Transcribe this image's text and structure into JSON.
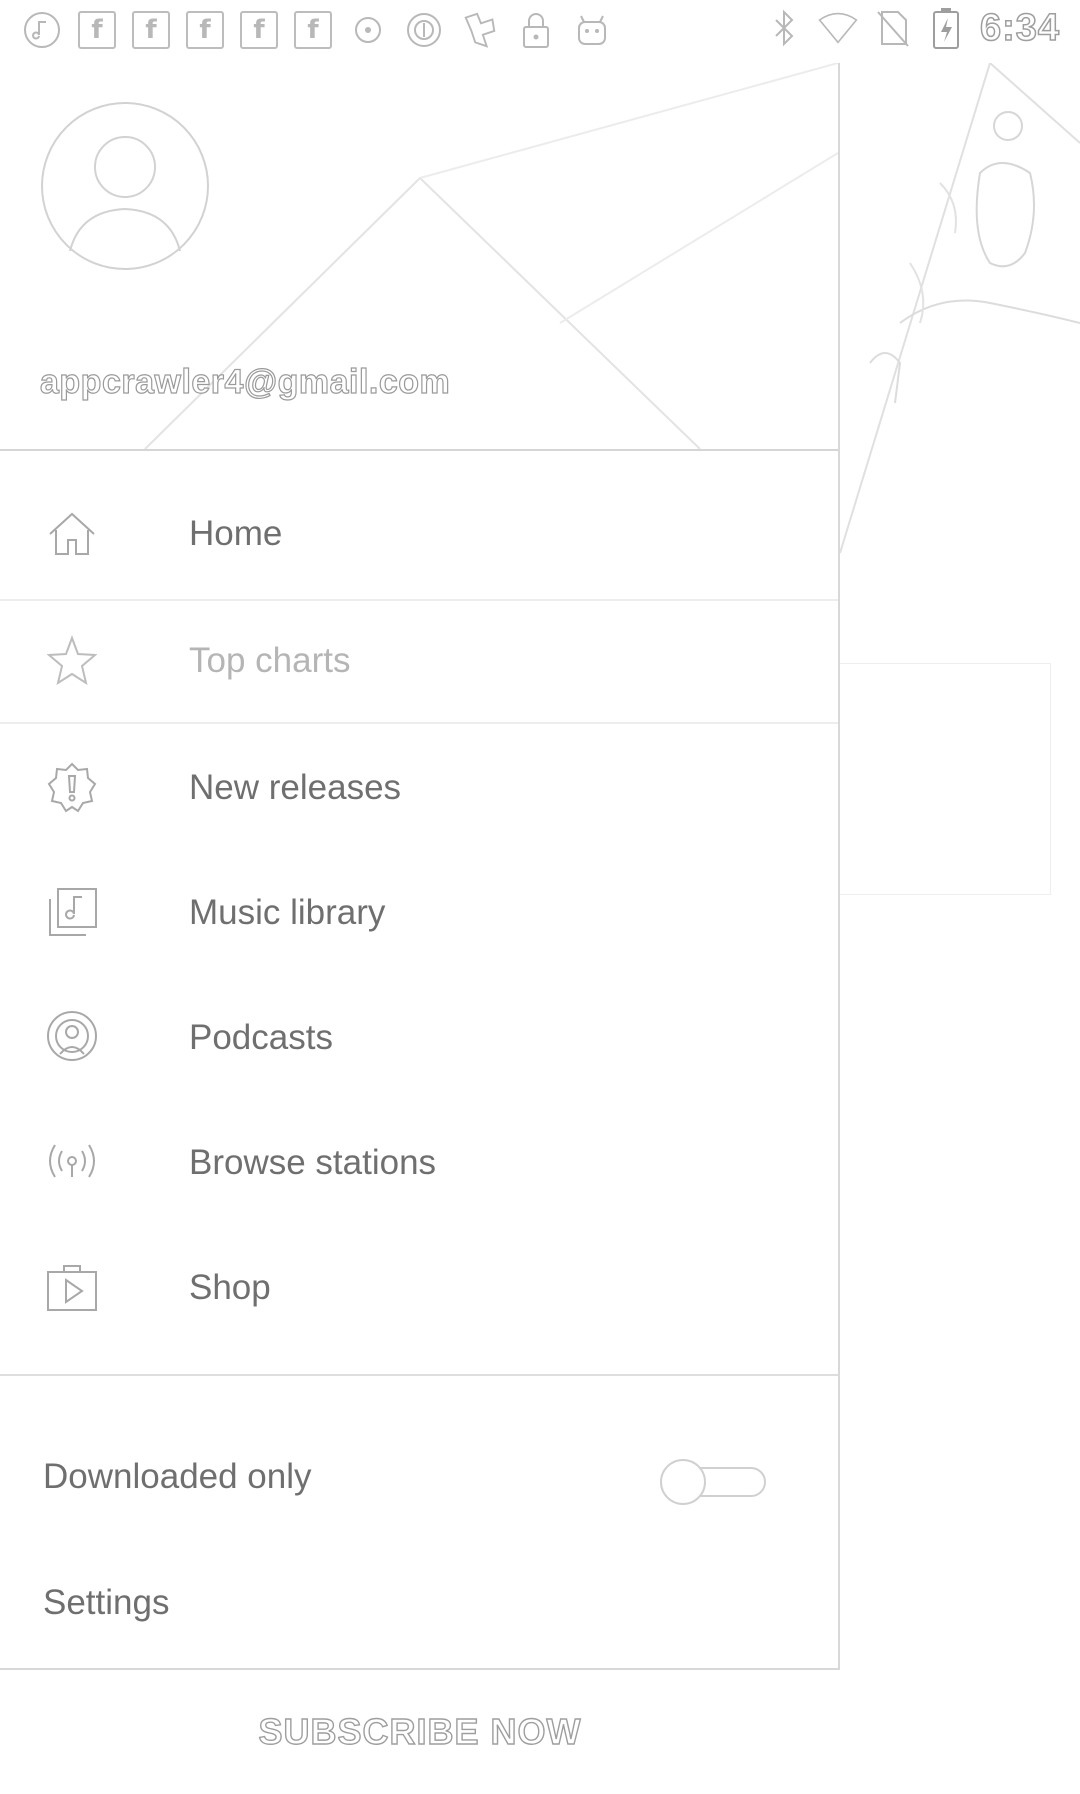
{
  "status_bar": {
    "time": "6:34",
    "left_icons": [
      "music-note-icon",
      "facebook-icon",
      "facebook-icon",
      "facebook-icon",
      "facebook-icon",
      "facebook-icon",
      "circle-dot-icon",
      "circle-line-icon",
      "app-icon",
      "lock-icon",
      "android-icon"
    ],
    "right_icons": [
      "bluetooth-icon",
      "wifi-icon",
      "no-sim-icon",
      "battery-charging-icon"
    ],
    "facebook_glyph": "f"
  },
  "drawer": {
    "account_email": "appcrawler4@gmail.com",
    "nav_items": [
      {
        "label": "Home",
        "icon": "home-icon"
      },
      {
        "label": "Top charts",
        "icon": "star-icon"
      },
      {
        "label": "New releases",
        "icon": "new-releases-icon"
      },
      {
        "label": "Music library",
        "icon": "music-library-icon"
      },
      {
        "label": "Podcasts",
        "icon": "podcasts-icon"
      },
      {
        "label": "Browse stations",
        "icon": "radio-icon"
      },
      {
        "label": "Shop",
        "icon": "shop-icon"
      }
    ],
    "downloaded_only": {
      "label": "Downloaded only",
      "enabled": false
    },
    "settings_label": "Settings"
  },
  "subscribe_label": "SUBSCRIBE NOW",
  "colors": {
    "text": "#6f6f6f",
    "dim_text": "#b5b5b5",
    "divider": "#dedede",
    "icon": "#a8a8a8"
  }
}
